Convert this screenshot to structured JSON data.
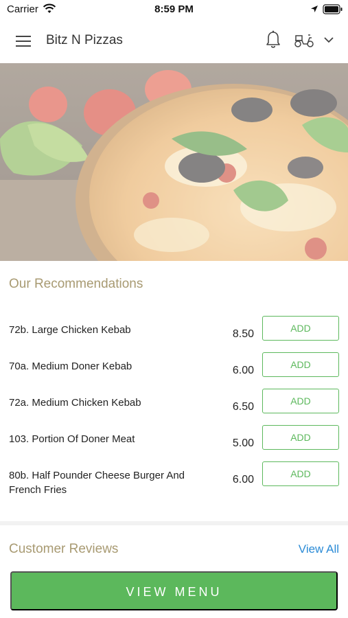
{
  "status_bar": {
    "carrier": "Carrier",
    "time": "8:59 PM"
  },
  "header": {
    "title": "Bitz N Pizzas",
    "icons": [
      "menu-icon",
      "bell-icon",
      "delivery-scooter-icon",
      "chevron-down-icon"
    ]
  },
  "hero": {
    "image": "pizza-hero-image"
  },
  "recommendations": {
    "title": "Our Recommendations",
    "items": [
      {
        "name": "72b. Large Chicken Kebab",
        "price": "8.50",
        "action": "ADD"
      },
      {
        "name": "70a. Medium Doner Kebab",
        "price": "6.00",
        "action": "ADD"
      },
      {
        "name": "72a. Medium Chicken Kebab",
        "price": "6.50",
        "action": "ADD"
      },
      {
        "name": "103. Portion Of Doner Meat",
        "price": "5.00",
        "action": "ADD"
      },
      {
        "name": "80b. Half Pounder Cheese Burger And French Fries",
        "price": "6.00",
        "action": "ADD"
      }
    ]
  },
  "reviews": {
    "title": "Customer Reviews",
    "view_all": "View All"
  },
  "footer": {
    "view_menu": "VIEW MENU"
  },
  "colors": {
    "accent_green": "#5cb85c",
    "section_title": "#a89a72",
    "link_blue": "#2b8bd6"
  }
}
